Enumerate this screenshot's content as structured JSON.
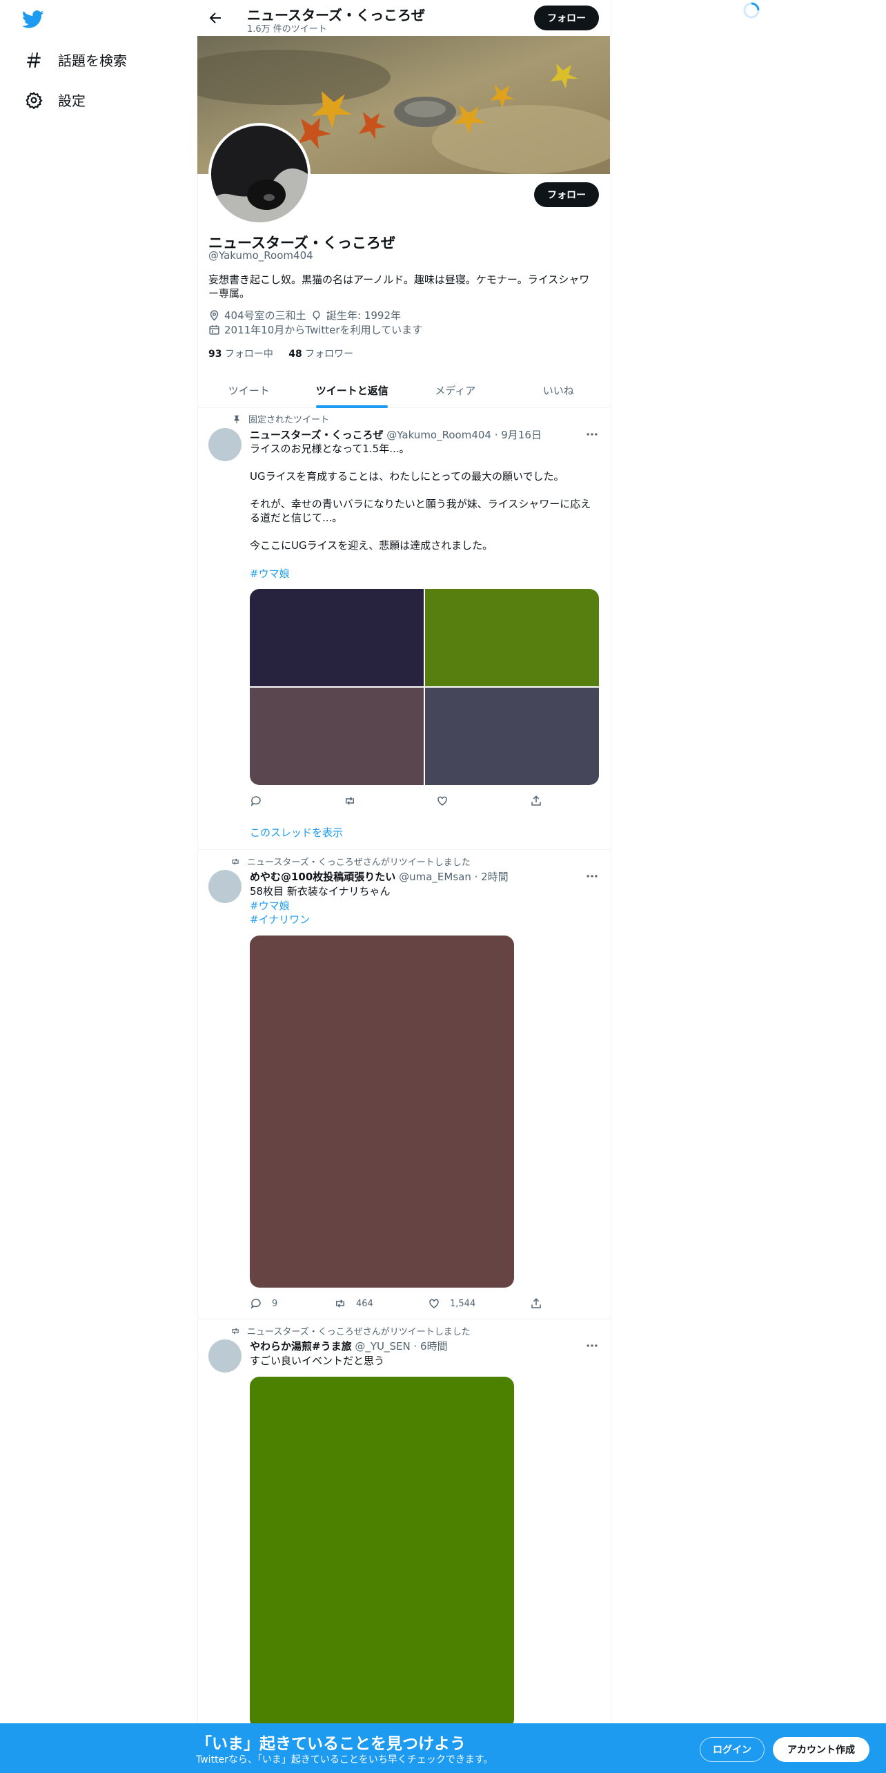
{
  "nav": {
    "explore_label": "話題を検索",
    "settings_label": "設定"
  },
  "header": {
    "name": "ニュースターズ・くっころぜ",
    "tweet_count": "1.6万 件のツイート",
    "follow_label": "フォロー"
  },
  "profile": {
    "follow_label": "フォロー",
    "name": "ニュースターズ・くっころぜ",
    "handle": "@Yakumo_Room404",
    "bio": "妄想書き起こし奴。黒猫の名はアーノルド。趣味は昼寝。ケモナー。ライスシャワー専属。",
    "location": "404号室の三和土",
    "birth": "誕生年: 1992年",
    "joined": "2011年10月からTwitterを利用しています",
    "following_count": "93",
    "following_label": "フォロー中",
    "followers_count": "48",
    "followers_label": "フォロワー"
  },
  "tabs": [
    {
      "label": "ツイート",
      "active": false
    },
    {
      "label": "ツイートと返信",
      "active": true
    },
    {
      "label": "メディア",
      "active": false
    },
    {
      "label": "いいね",
      "active": false
    }
  ],
  "tweets": [
    {
      "context": "固定されたツイート",
      "name": "ニュースターズ・くっころぜ",
      "meta": "@Yakumo_Room404 · 9月16日",
      "lines": [
        "ライスのお兄様となって1.5年...。",
        "UGライスを育成することは、わたしにとっての最大の願いでした。",
        "それが、幸せの青いバラになりたいと願う我が妹、ライスシャワーに応える道だと信じて...。",
        "今ここにUGライスを迎え、悲願は達成されました。"
      ],
      "hashtags": [
        "#ウマ娘"
      ],
      "media_colors": [
        "#27223d",
        "#577f0f",
        "#5a464e",
        "#454659"
      ],
      "show_thread": "このスレッドを表示"
    },
    {
      "context": "ニュースターズ・くっころぜさんがリツイートしました",
      "name": "めやむ@100枚投稿頑張りたい",
      "meta": "@uma_EMsan · 2時間",
      "lines": [
        "58枚目 新衣装なイナリちゃん"
      ],
      "hashtags": [
        "#ウマ娘",
        "#イナリワン"
      ],
      "media_colors": [
        "#664443"
      ],
      "replies": "9",
      "retweets": "464",
      "likes": "1,544"
    },
    {
      "context": "ニュースターズ・くっころぜさんがリツイートしました",
      "name": "やわらか湯煎#うま旅",
      "meta": "@_YU_SEN · 6時間",
      "lines": [
        "すごい良いイベントだと思う"
      ],
      "hashtags": [],
      "media_colors": [
        "#4c8100"
      ]
    }
  ],
  "bottom_bar": {
    "title": "「いま」起きていることを見つけよう",
    "subtitle": "Twitterなら、「いま」起きていることをいち早くチェックできます。",
    "login_label": "ログイン",
    "signup_label": "アカウント作成"
  },
  "colors": {
    "accent": "#1d9bf0",
    "dark_button": "#0f1419",
    "muted_text": "#536471"
  }
}
